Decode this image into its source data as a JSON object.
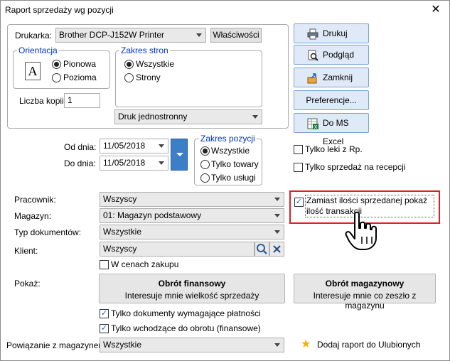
{
  "window": {
    "title": "Raport sprzedaży wg pozycji",
    "close_glyph": "✕"
  },
  "printer": {
    "label": "Drukarka:",
    "selected": "Brother DCP-J152W Printer",
    "properties_button": "Właściwości"
  },
  "orientation": {
    "legend": "Orientacja",
    "icon_letter": "A",
    "options": [
      "Pionowa",
      "Pozioma"
    ],
    "selected_index": 0
  },
  "page_range": {
    "legend": "Zakres stron",
    "options": [
      "Wszystkie",
      "Strony"
    ],
    "selected_index": 0
  },
  "copies": {
    "label": "Liczba kopii:",
    "value": "1"
  },
  "duplex": {
    "selected": "Druk jednostronny"
  },
  "actions": {
    "print": "Drukuj",
    "preview": "Podgląd",
    "close": "Zamknij",
    "preferences": "Preferencje...",
    "excel": "Do MS Excel"
  },
  "dates": {
    "from_label": "Od dnia:",
    "from_value": "11/05/2018",
    "to_label": "Do dnia:",
    "to_value": "11/05/2018"
  },
  "item_range": {
    "legend": "Zakres pozycji",
    "options": [
      "Wszystkie",
      "Tylko towary",
      "Tylko usługi"
    ],
    "selected_index": 0
  },
  "right_checks": {
    "rx_only": "Tylko leki z Rp.",
    "reception_only": "Tylko sprzedaż na recepcji",
    "transactions_count": "Zamiast ilości sprzedanej pokaż ilość transakcji",
    "transactions_checked": true
  },
  "filters": {
    "employee_label": "Pracownik:",
    "employee_value": "Wszyscy",
    "warehouse_label": "Magazyn:",
    "warehouse_value": "01: Magazyn podstawowy",
    "doc_type_label": "Typ dokumentów:",
    "doc_type_value": "Wszystkie",
    "client_label": "Klient:",
    "client_value": "Wszyscy",
    "purchase_prices": "W cenach zakupu"
  },
  "show": {
    "label": "Pokaż:",
    "financial_title": "Obrót finansowy",
    "financial_sub": "Interesuje mnie wielkość sprzedaży",
    "warehouse_title": "Obrót magazynowy",
    "warehouse_sub": "Interesuje mnie co zeszło z magazynu"
  },
  "bottom_checks": {
    "payment_docs": "Tylko dokumenty wymagające płatności",
    "financial_turnover": "Tylko wchodzące do obrotu (finansowe)"
  },
  "warehouse_link": {
    "label": "Powiązanie z magazynem:",
    "value": "Wszystkie"
  },
  "favorites": {
    "label": "Dodaj raport do Ulubionych"
  }
}
